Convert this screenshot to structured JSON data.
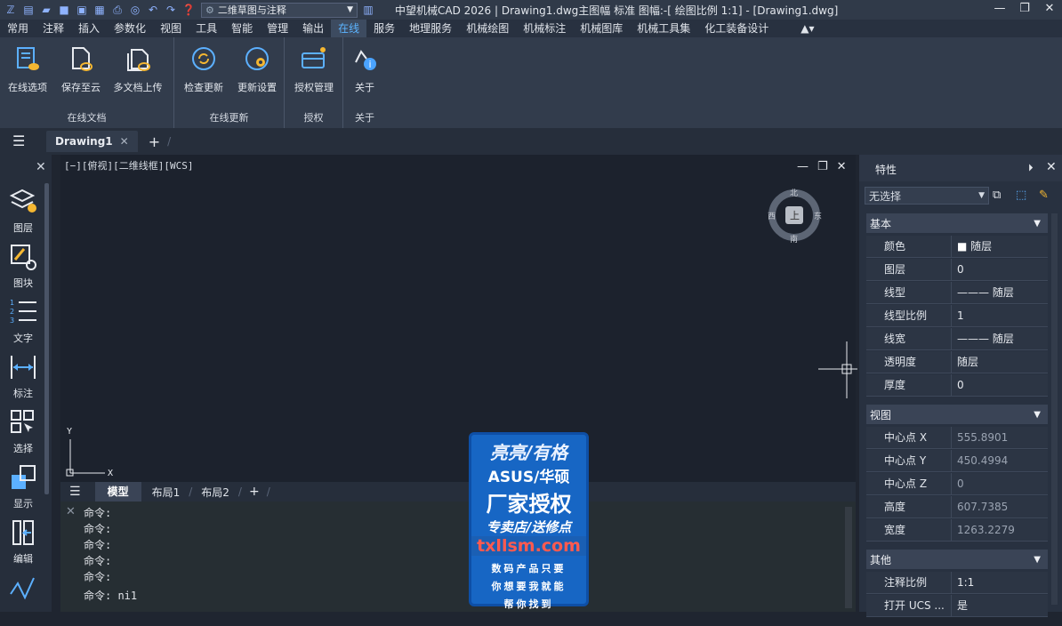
{
  "titlebar": {
    "workspace": "二维草图与注释",
    "title": "中望机械CAD 2026 | Drawing1.dwg主图幅  标准 图幅:-[ 绘图比例 1:1] - [Drawing1.dwg]"
  },
  "menu": [
    "常用",
    "注释",
    "插入",
    "参数化",
    "视图",
    "工具",
    "智能",
    "管理",
    "输出",
    "在线",
    "服务",
    "地理服务",
    "机械绘图",
    "机械标注",
    "机械图库",
    "机械工具集",
    "化工装备设计"
  ],
  "ribbon": {
    "groups": [
      {
        "name": "在线文档",
        "buttons": [
          "在线选项",
          "保存至云",
          "多文档上传"
        ]
      },
      {
        "name": "在线更新",
        "buttons": [
          "检查更新",
          "更新设置"
        ]
      },
      {
        "name": "授权",
        "buttons": [
          "授权管理"
        ]
      },
      {
        "name": "关于",
        "buttons": [
          "关于"
        ]
      }
    ]
  },
  "doc_tab": "Drawing1",
  "left_panel": [
    "图层",
    "图块",
    "文字",
    "标注",
    "选择",
    "显示",
    "编辑"
  ],
  "viewport": {
    "label": "[−][俯视][二维线框][WCS]",
    "compass": {
      "n": "北",
      "s": "南",
      "e": "东",
      "w": "西",
      "center": "上"
    },
    "ucs": {
      "x": "X",
      "y": "Y"
    }
  },
  "layout_tabs": [
    "模型",
    "布局1",
    "布局2"
  ],
  "command_lines": [
    "命令:",
    "命令:",
    "命令:",
    "命令:",
    "命令:",
    "命令: ni1"
  ],
  "properties": {
    "title": "特性",
    "selection": "无选择",
    "sections": [
      {
        "name": "基本",
        "rows": [
          [
            "颜色",
            "随层"
          ],
          [
            "图层",
            "0"
          ],
          [
            "线型",
            "随层"
          ],
          [
            "线型比例",
            "1"
          ],
          [
            "线宽",
            "随层"
          ],
          [
            "透明度",
            "随层"
          ],
          [
            "厚度",
            "0"
          ]
        ]
      },
      {
        "name": "视图",
        "rows": [
          [
            "中心点 X",
            "555.8901"
          ],
          [
            "中心点 Y",
            "450.4994"
          ],
          [
            "中心点 Z",
            "0"
          ],
          [
            "高度",
            "607.7385"
          ],
          [
            "宽度",
            "1263.2279"
          ]
        ]
      },
      {
        "name": "其他",
        "rows": [
          [
            "注释比例",
            "1:1"
          ],
          [
            "打开 UCS ...",
            "是"
          ]
        ]
      }
    ]
  },
  "overlay_ad": [
    "亮亮/有格",
    "ASUS/华硕",
    "厂家授权",
    "专卖店/送修点",
    "txllsm.com",
    "数码产品只要",
    "你想要我就能",
    "帮你找到"
  ]
}
